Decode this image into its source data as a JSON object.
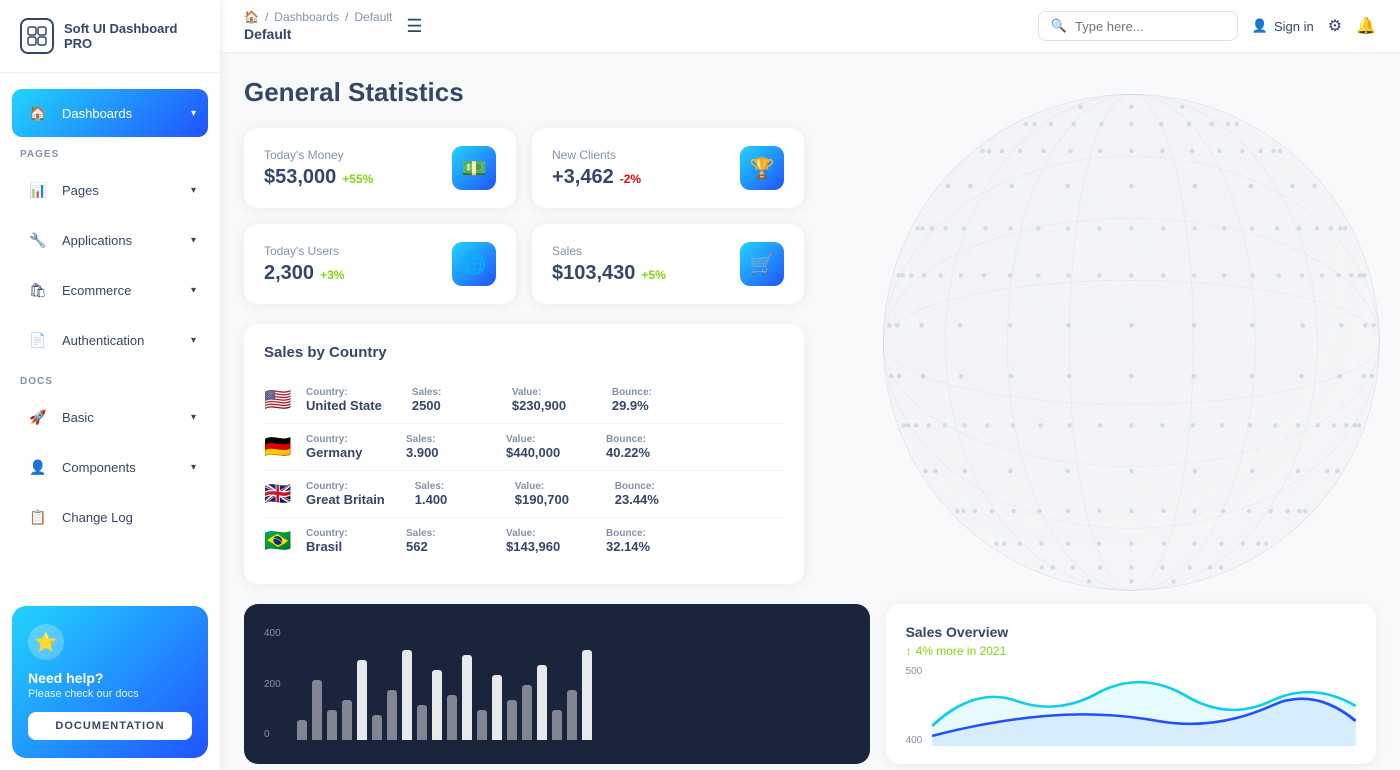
{
  "sidebar": {
    "logo": {
      "icon": "⊞",
      "text": "Soft UI Dashboard PRO"
    },
    "sections": [
      {
        "label": "",
        "items": [
          {
            "id": "dashboards",
            "label": "Dashboards",
            "icon": "🏠",
            "active": true,
            "hasChevron": true
          }
        ]
      },
      {
        "label": "PAGES",
        "items": [
          {
            "id": "pages",
            "label": "Pages",
            "icon": "📊",
            "active": false,
            "hasChevron": true
          },
          {
            "id": "applications",
            "label": "Applications",
            "icon": "🔧",
            "active": false,
            "hasChevron": true
          },
          {
            "id": "ecommerce",
            "label": "Ecommerce",
            "icon": "🛍",
            "active": false,
            "hasChevron": true
          },
          {
            "id": "authentication",
            "label": "Authentication",
            "icon": "📄",
            "active": false,
            "hasChevron": true
          }
        ]
      },
      {
        "label": "DOCS",
        "items": [
          {
            "id": "basic",
            "label": "Basic",
            "icon": "🚀",
            "active": false,
            "hasChevron": true
          },
          {
            "id": "components",
            "label": "Components",
            "icon": "👤",
            "active": false,
            "hasChevron": true
          },
          {
            "id": "changelog",
            "label": "Change Log",
            "icon": "📋",
            "active": false,
            "hasChevron": false
          }
        ]
      }
    ],
    "help": {
      "star": "⭐",
      "title": "Need help?",
      "subtitle": "Please check our docs",
      "button_label": "DOCUMENTATION"
    }
  },
  "header": {
    "breadcrumb": {
      "home_icon": "🏠",
      "items": [
        "Dashboards",
        "Default"
      ],
      "current": "Default"
    },
    "hamburger_icon": "☰",
    "search_placeholder": "Type here...",
    "sign_in_label": "Sign in",
    "user_icon": "👤",
    "settings_icon": "⚙",
    "bell_icon": "🔔"
  },
  "main": {
    "page_title": "General Statistics",
    "stats": [
      {
        "label": "Today's Money",
        "value": "$53,000",
        "change": "+55%",
        "change_type": "pos",
        "icon": "💵"
      },
      {
        "label": "New Clients",
        "value": "+3,462",
        "change": "-2%",
        "change_type": "neg",
        "icon": "🏆"
      },
      {
        "label": "Today's Users",
        "value": "2,300",
        "change": "+3%",
        "change_type": "pos",
        "icon": "🌐"
      },
      {
        "label": "Sales",
        "value": "$103,430",
        "change": "+5%",
        "change_type": "pos",
        "icon": "🛒"
      }
    ],
    "sales_by_country": {
      "title": "Sales by Country",
      "columns": [
        "Country:",
        "Sales:",
        "Value:",
        "Bounce:"
      ],
      "rows": [
        {
          "flag": "🇺🇸",
          "country": "United State",
          "sales": "2500",
          "value": "$230,900",
          "bounce": "29.9%"
        },
        {
          "flag": "🇩🇪",
          "country": "Germany",
          "sales": "3.900",
          "value": "$440,000",
          "bounce": "40.22%"
        },
        {
          "flag": "🇬🇧",
          "country": "Great Britain",
          "sales": "1.400",
          "value": "$190,700",
          "bounce": "23.44%"
        },
        {
          "flag": "🇧🇷",
          "country": "Brasil",
          "sales": "562",
          "value": "$143,960",
          "bounce": "32.14%"
        }
      ]
    },
    "bar_chart": {
      "y_labels": [
        "400",
        "200",
        "0"
      ],
      "bars": [
        20,
        60,
        30,
        40,
        80,
        25,
        50,
        90,
        35,
        70,
        45,
        85,
        30,
        65,
        40,
        55,
        75,
        30,
        50,
        90
      ]
    },
    "sales_overview": {
      "title": "Sales Overview",
      "subtitle": "4% more in 2021",
      "y_labels": [
        "500",
        "400"
      ]
    }
  }
}
